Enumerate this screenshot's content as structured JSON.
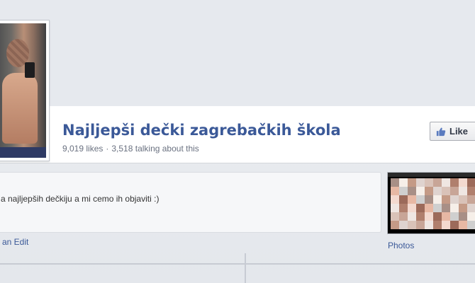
{
  "page": {
    "title": "Najljepši dečki zagrebačkih škola",
    "likes_text": "9,019 likes",
    "separator": "·",
    "talking_text": "3,518 talking about this"
  },
  "actions": {
    "like_label": "Like"
  },
  "about": {
    "text": "a najljepših dečkiju a mi cemo ih objaviti :)",
    "suggest_edit_label": "an Edit"
  },
  "photos": {
    "label": "Photos"
  },
  "colors": {
    "link": "#3b5998",
    "muted": "#6a7180"
  },
  "icons": {
    "like": "thumbs-up-icon"
  }
}
